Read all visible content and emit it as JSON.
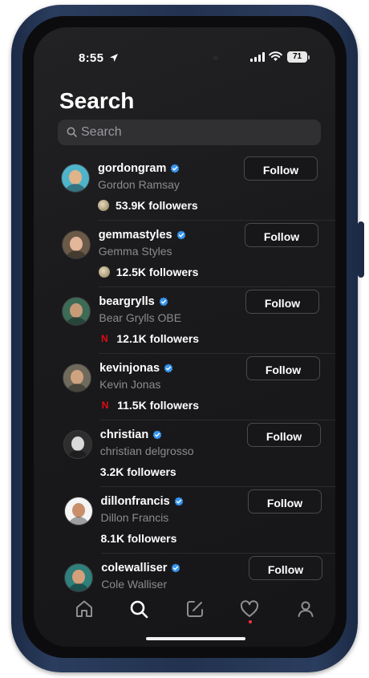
{
  "status_bar": {
    "time": "8:55",
    "battery": "71"
  },
  "page": {
    "title": "Search"
  },
  "search": {
    "placeholder": "Search"
  },
  "users": [
    {
      "username": "gordongram",
      "full_name": "Gordon Ramsay",
      "followers": "53.9K followers",
      "follower_icon": "globe",
      "avatar_color": "#4fb3c9",
      "face_color": "#e0b48a"
    },
    {
      "username": "gemmastyles",
      "full_name": "Gemma Styles",
      "followers": "12.5K followers",
      "follower_icon": "globe",
      "avatar_color": "#6b5a48",
      "face_color": "#e4b79a"
    },
    {
      "username": "beargrylls",
      "full_name": "Bear Grylls OBE",
      "followers": "12.1K followers",
      "follower_icon": "netflix",
      "avatar_color": "#3d6b56",
      "face_color": "#c79a78"
    },
    {
      "username": "kevinjonas",
      "full_name": "Kevin Jonas",
      "followers": "11.5K followers",
      "follower_icon": "netflix",
      "avatar_color": "#6f6a5c",
      "face_color": "#cfa37f"
    },
    {
      "username": "christian",
      "full_name": "christian delgrosso",
      "followers": "3.2K followers",
      "follower_icon": "none",
      "avatar_color": "#2e2e2e",
      "face_color": "#d9d9d9"
    },
    {
      "username": "dillonfrancis",
      "full_name": "Dillon Francis",
      "followers": "8.1K followers",
      "follower_icon": "none",
      "avatar_color": "#f4f4f4",
      "face_color": "#c98f6c"
    },
    {
      "username": "colewalliser",
      "full_name": "Cole Walliser",
      "followers": "",
      "follower_icon": "none",
      "avatar_color": "#2f7f7a",
      "face_color": "#d4a07c"
    }
  ],
  "buttons": {
    "follow_label": "Follow"
  },
  "colors": {
    "verified": "#3897f0",
    "notification_dot": "#ff3040"
  }
}
